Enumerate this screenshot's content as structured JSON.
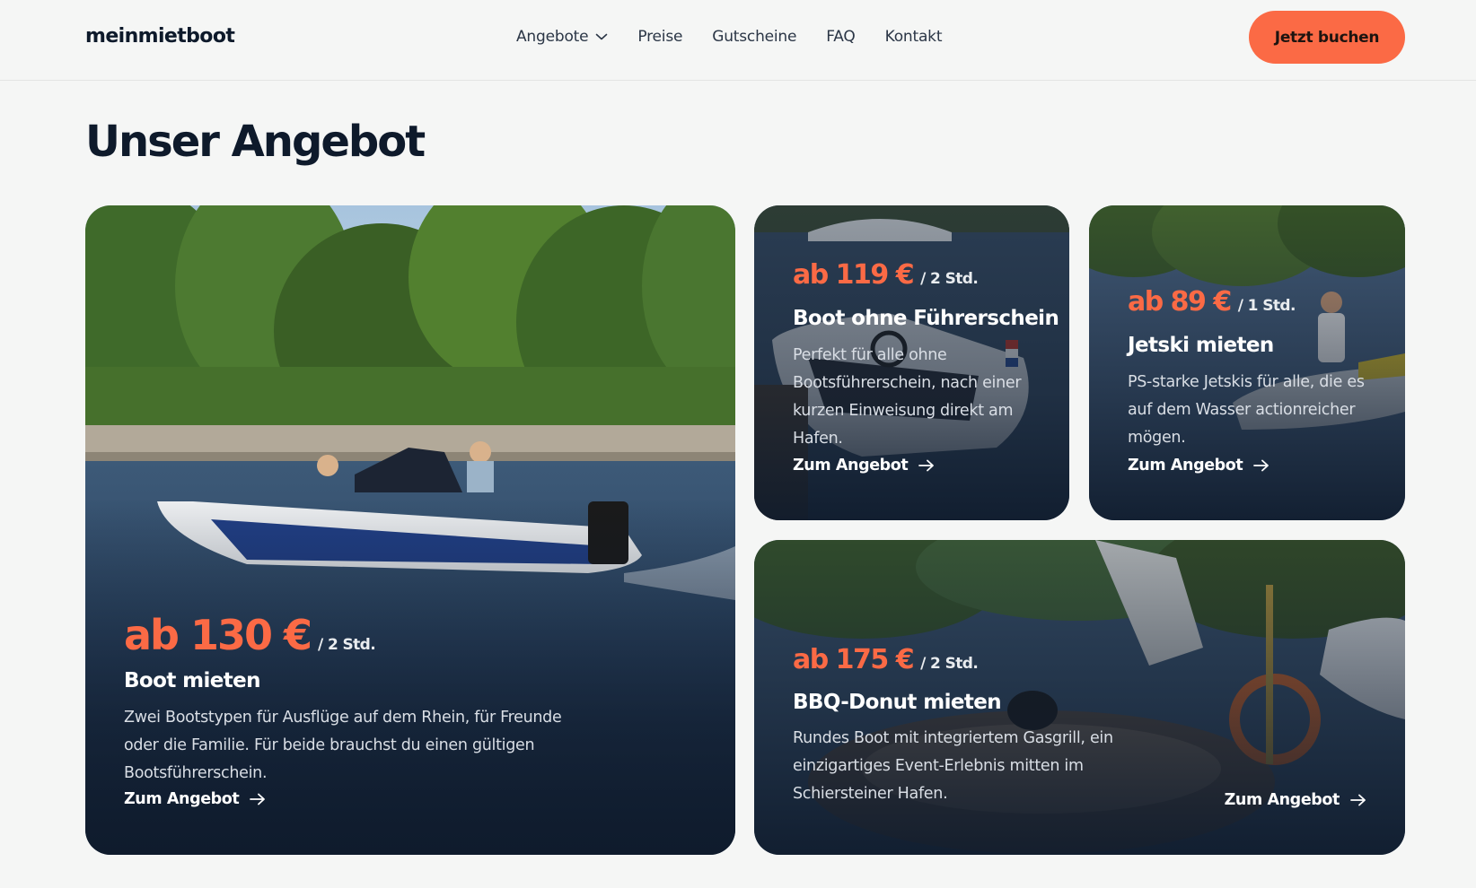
{
  "header": {
    "logo": "meinmietboot",
    "nav": [
      {
        "label": "Angebote",
        "has_dropdown": true
      },
      {
        "label": "Preise"
      },
      {
        "label": "Gutscheine"
      },
      {
        "label": "FAQ"
      },
      {
        "label": "Kontakt"
      }
    ],
    "cta_label": "Jetzt buchen"
  },
  "main": {
    "title": "Unser Angebot",
    "cards": [
      {
        "price": "ab 130 €",
        "unit": "/ 2 Std.",
        "title": "Boot mieten",
        "description": "Zwei Bootstypen für Ausflüge auf dem Rhein, für Freunde oder die Familie. Für beide brauchst du einen gültigen Bootsführerschein.",
        "link": "Zum Angebot"
      },
      {
        "price": "ab 119 €",
        "unit": "/ 2 Std.",
        "title": "Boot ohne Führerschein",
        "description": "Perfekt für alle ohne Bootsführerschein, nach einer kurzen Einweisung direkt am Hafen.",
        "link": "Zum Angebot"
      },
      {
        "price": "ab 89 €",
        "unit": "/ 1 Std.",
        "title": "Jetski mieten",
        "description": "PS-starke Jetskis für alle, die es auf dem Wasser actionreicher mögen.",
        "link": "Zum Angebot"
      },
      {
        "price": "ab 175 €",
        "unit": "/ 2 Std.",
        "title": "BBQ-Donut mieten",
        "description": "Rundes Boot mit integriertem Gasgrill, ein einzigartiges Event-Erlebnis mitten im Schiersteiner Hafen.",
        "link": "Zum Angebot"
      }
    ]
  },
  "colors": {
    "accent": "#fb6a45",
    "dark": "#0e1a2b",
    "background": "#f5f6f5"
  }
}
